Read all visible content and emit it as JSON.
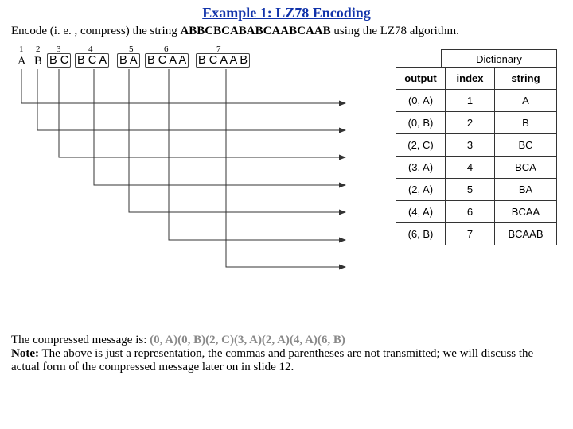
{
  "title": "Example 1: LZ78 Encoding",
  "prompt_pre": "Encode (i. e. , compress) the string ",
  "prompt_str": "ABBCBCABABCAABCAAB",
  "prompt_post": " using the LZ78 algorithm.",
  "groups": {
    "nums": [
      "1",
      "2",
      "3",
      "4",
      "5",
      "6",
      "7"
    ],
    "g1": "A",
    "g2": "B",
    "g3": "B C",
    "g4": "B C A",
    "g5": "B A",
    "g6": "B C A A",
    "g7": "B C A A B"
  },
  "dict": {
    "caption": "Dictionary",
    "headers": {
      "out": "output",
      "idx": "index",
      "str": "string"
    },
    "rows": [
      {
        "out": "(0, A)",
        "idx": "1",
        "str": "A"
      },
      {
        "out": "(0, B)",
        "idx": "2",
        "str": "B"
      },
      {
        "out": "(2, C)",
        "idx": "3",
        "str": "BC"
      },
      {
        "out": "(3, A)",
        "idx": "4",
        "str": "BCA"
      },
      {
        "out": "(2, A)",
        "idx": "5",
        "str": "BA"
      },
      {
        "out": "(4, A)",
        "idx": "6",
        "str": "BCAA"
      },
      {
        "out": "(6, B)",
        "idx": "7",
        "str": "BCAAB"
      }
    ]
  },
  "footer": {
    "msg_pre": " The compressed message is: ",
    "msg_val": "(0, A)(0, B)(2, C)(3, A)(2, A)(4, A)(6, B)",
    "note_label": "Note:",
    "note_text": " The above is just a representation, the commas and parentheses are not transmitted; we will discuss the actual form of the compressed message later on in slide 12."
  }
}
